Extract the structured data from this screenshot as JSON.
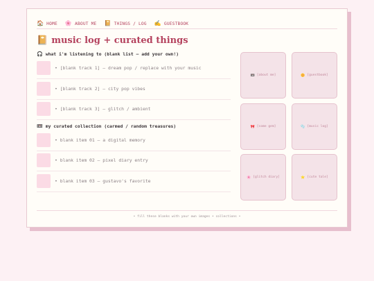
{
  "nav": [
    {
      "icon": "🏠",
      "label": "HOME",
      "icon_name": "home-icon"
    },
    {
      "icon": "🌸",
      "label": "ABOUT ME",
      "icon_name": "flower-icon"
    },
    {
      "icon": "📔",
      "label": "THINGS / LOG",
      "icon_name": "notebook-icon"
    },
    {
      "icon": "✍️",
      "label": "GUESTBOOK",
      "icon_name": "writing-hand-icon"
    }
  ],
  "page": {
    "title_icon": "📔",
    "title": "music log + curated things"
  },
  "music": {
    "icon": "🎧",
    "heading": "what i'm listening to (blank list — add your own!)",
    "tracks": [
      "• [blank track 1] — dream pop / replace with your music",
      "• [blank track 2] — city pop vibes",
      "• [blank track 3] — glitch / ambient"
    ]
  },
  "collection": {
    "icon": "📼",
    "heading": "my curated collection (carmed / random treasures)",
    "items": [
      "• blank item 01 — a digital memory",
      "• blank item 02 — pixel diary entry",
      "• blank item 03 — gustavo's favorite"
    ]
  },
  "tiles": [
    {
      "icon": "📼",
      "label": "[about me]"
    },
    {
      "icon": "🌼",
      "label": "[guestbook]"
    },
    {
      "icon": "🎀",
      "label": "[some gem]"
    },
    {
      "icon": "🫧",
      "label": "[music log]"
    },
    {
      "icon": "🌸",
      "label": "[glitch diary]"
    },
    {
      "icon": "⭐",
      "label": "[cute tale]"
    }
  ],
  "footer": "• fill these blanks with your own images • collections •",
  "colors": {
    "accent": "#b4415d",
    "background": "#fdf1f4",
    "card": "#fffdf8",
    "tile": "#f4e3e8",
    "thumb": "#fbdbe5"
  }
}
